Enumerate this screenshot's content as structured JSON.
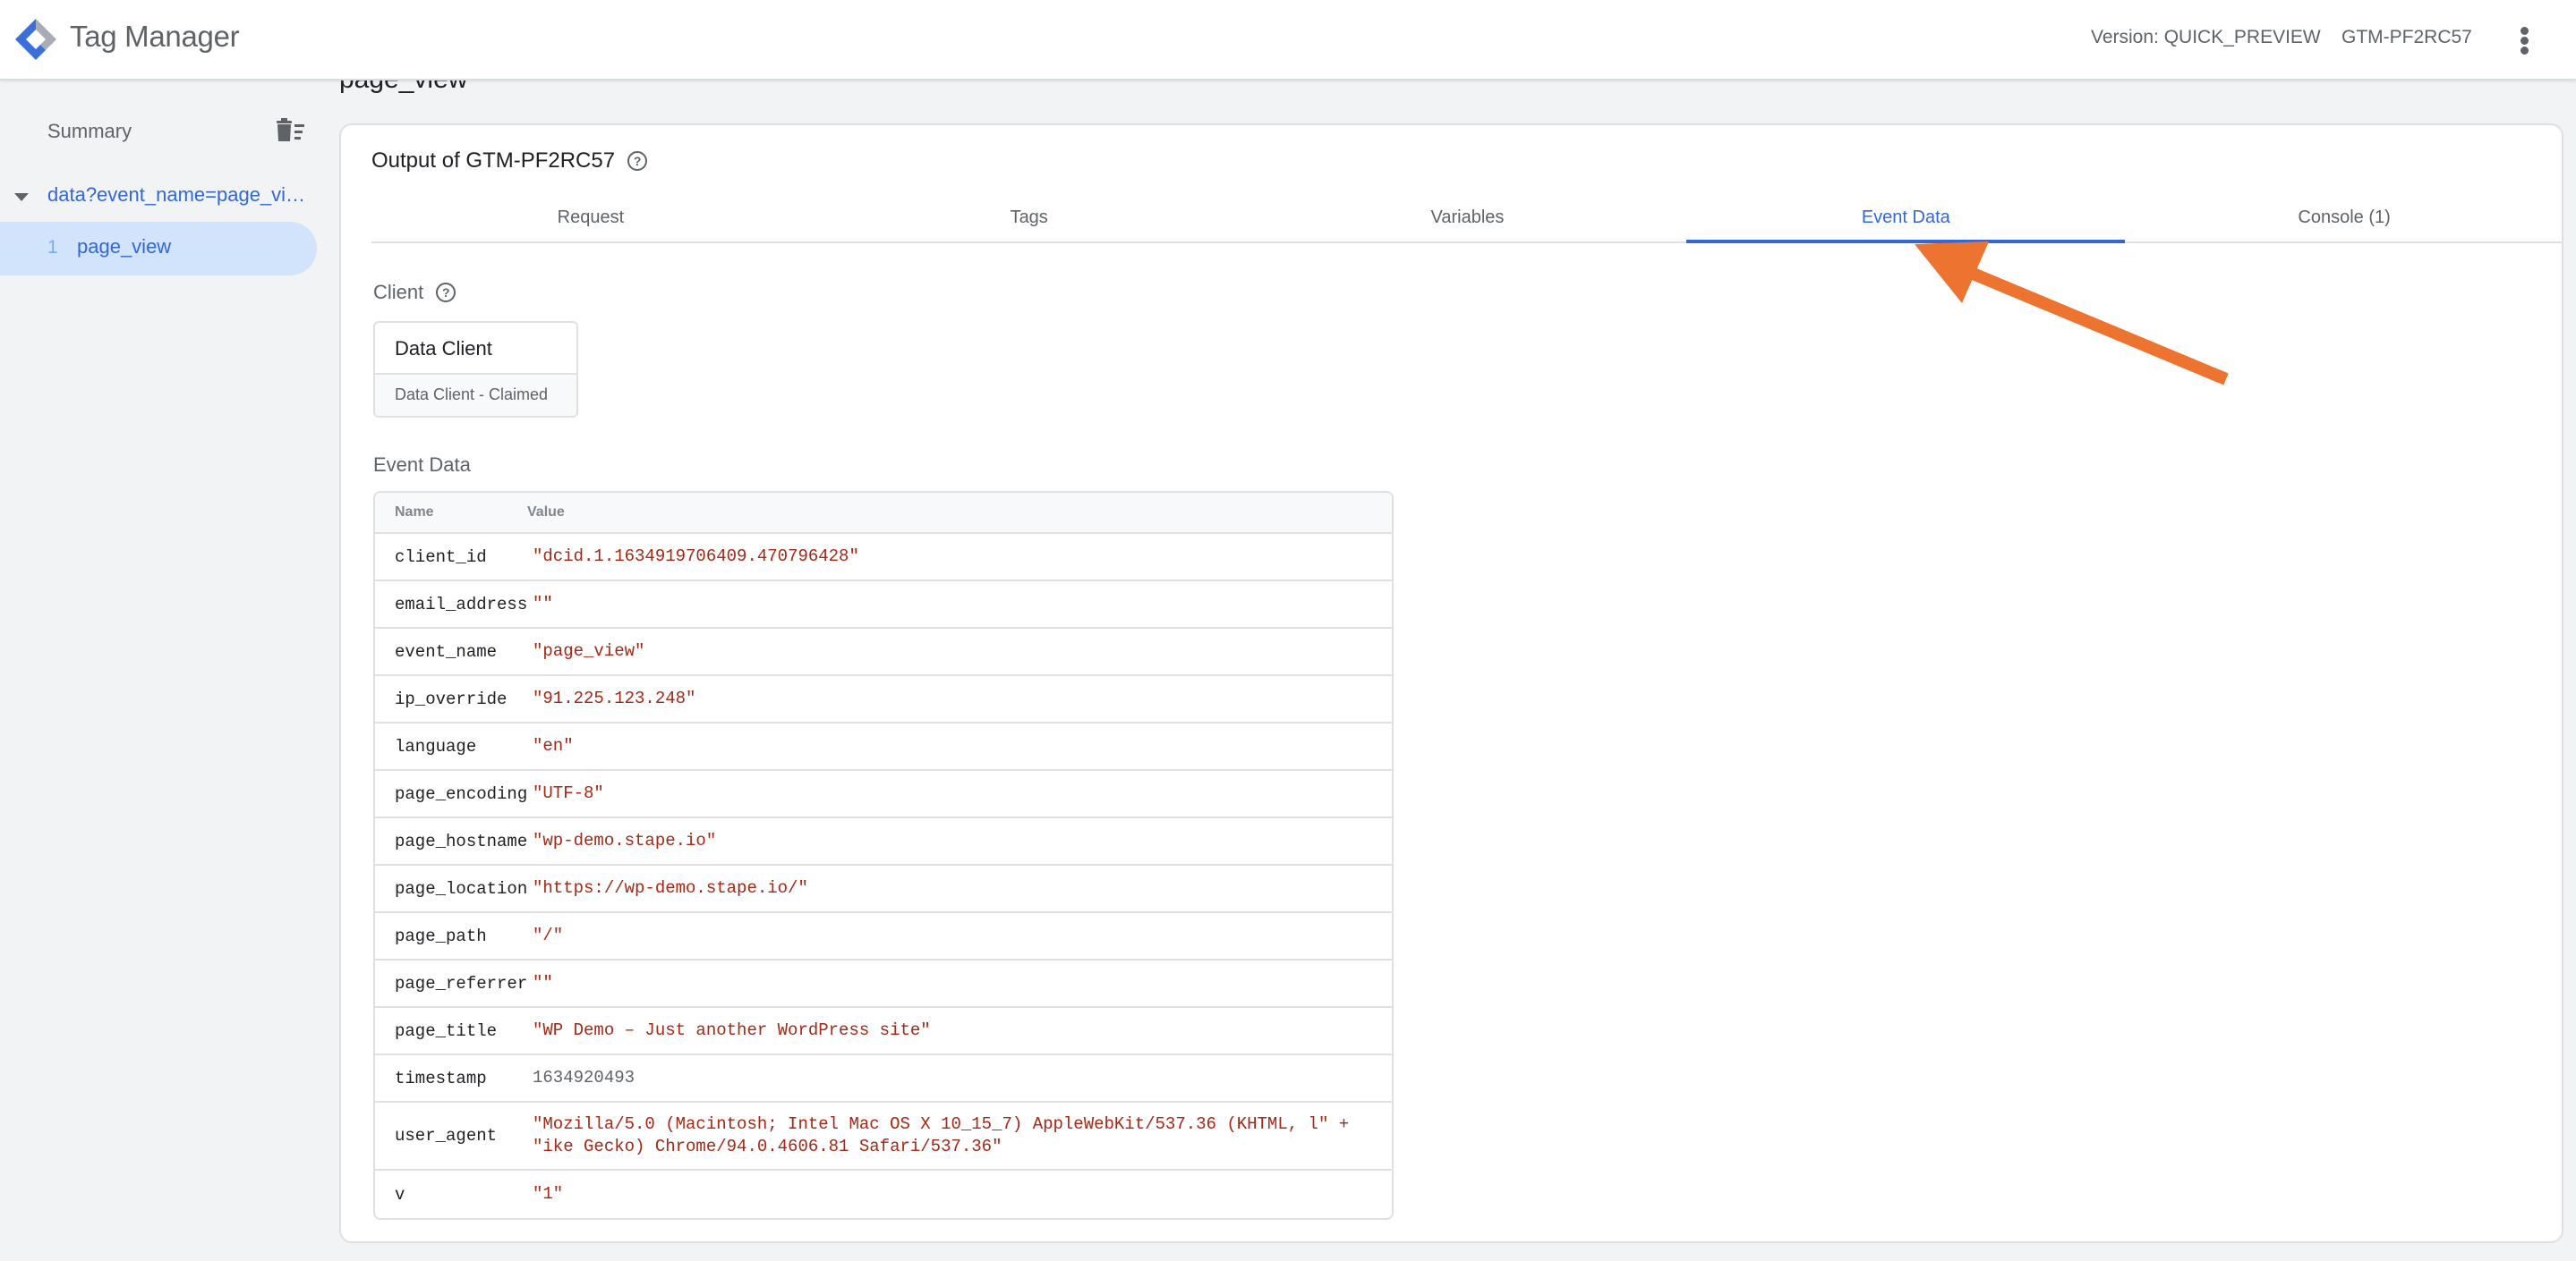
{
  "header": {
    "app_title": "Tag Manager",
    "version_label": "Version: QUICK_PREVIEW",
    "container_id": "GTM-PF2RC57",
    "more_menu_icon": "more-vert-icon"
  },
  "sidebar": {
    "summary_label": "Summary",
    "clear_icon": "delete-sweep-icon",
    "event_group": {
      "label": "data?event_name=page_vi…",
      "expanded": true
    },
    "events": [
      {
        "number": "1",
        "name": "page_view",
        "selected": true
      }
    ]
  },
  "main": {
    "page_heading": "page_view",
    "output_title": "Output of GTM-PF2RC57",
    "tabs": [
      {
        "label": "Request",
        "active": false
      },
      {
        "label": "Tags",
        "active": false
      },
      {
        "label": "Variables",
        "active": false
      },
      {
        "label": "Event Data",
        "active": true
      },
      {
        "label": "Console (1)",
        "active": false
      }
    ],
    "client_section": {
      "label": "Client",
      "client_name": "Data Client",
      "client_status": "Data Client - Claimed"
    },
    "event_data_section": {
      "label": "Event Data",
      "columns": [
        "Name",
        "Value"
      ],
      "rows": [
        {
          "name": "client_id",
          "value": "\"dcid.1.1634919706409.470796428\""
        },
        {
          "name": "email_address",
          "value": "\"\""
        },
        {
          "name": "event_name",
          "value": "\"page_view\""
        },
        {
          "name": "ip_override",
          "value": "\"91.225.123.248\""
        },
        {
          "name": "language",
          "value": "\"en\""
        },
        {
          "name": "page_encoding",
          "value": "\"UTF-8\""
        },
        {
          "name": "page_hostname",
          "value": "\"wp-demo.stape.io\""
        },
        {
          "name": "page_location",
          "value": "\"https://wp-demo.stape.io/\""
        },
        {
          "name": "page_path",
          "value": "\"/\""
        },
        {
          "name": "page_referrer",
          "value": "\"\""
        },
        {
          "name": "page_title",
          "value": "\"WP Demo – Just another WordPress site\""
        },
        {
          "name": "timestamp",
          "value": "1634920493"
        },
        {
          "name": "user_agent",
          "value": "\"Mozilla/5.0 (Macintosh; Intel Mac OS X 10_15_7) AppleWebKit/537.36 (KHTML, l\" +\n\"ike Gecko) Chrome/94.0.4606.81 Safari/537.36\""
        },
        {
          "name": "v",
          "value": "\"1\""
        }
      ]
    }
  },
  "annotation": {
    "type": "arrow",
    "points_to": "Event Data tab",
    "color": "#ed7430"
  },
  "colors": {
    "accent": "#3367d6",
    "string_value": "#a52714",
    "selected_bg": "#d2e3fc"
  }
}
